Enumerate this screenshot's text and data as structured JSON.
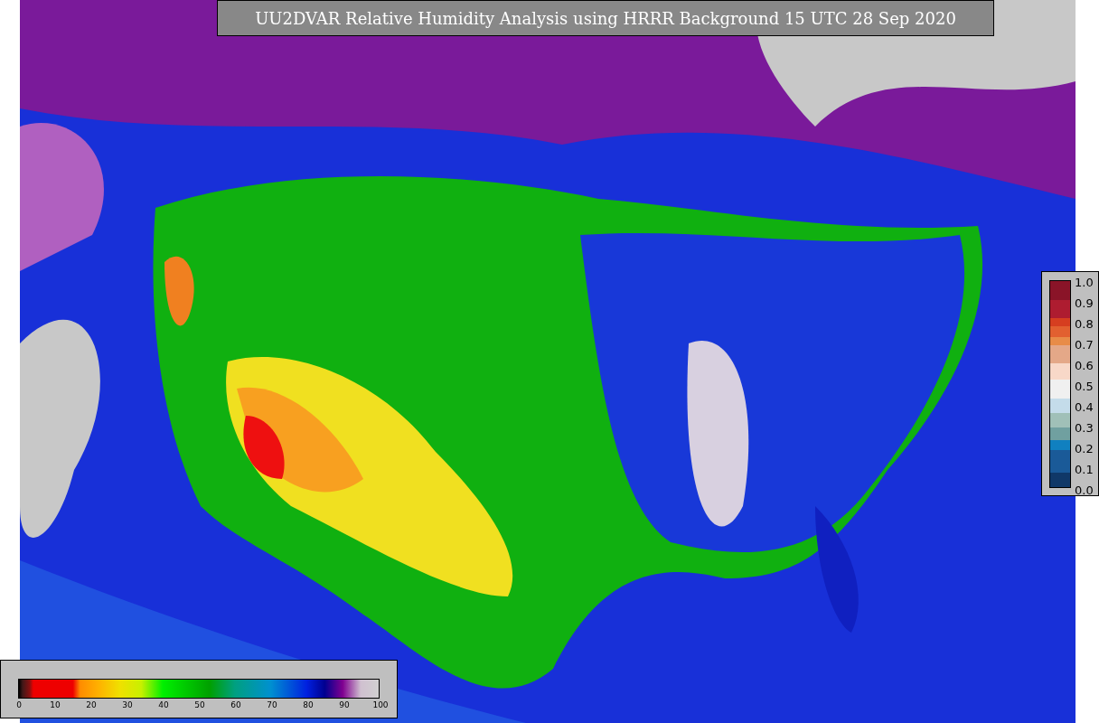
{
  "title": "UU2DVAR Relative Humidity Analysis using HRRR Background 15 UTC 28 Sep 2020",
  "humidity_scale": {
    "ticks": [
      "0",
      "10",
      "20",
      "30",
      "40",
      "50",
      "60",
      "70",
      "80",
      "90",
      "100"
    ]
  },
  "side_scale": {
    "ticks": [
      "1.0",
      "0.9",
      "0.8",
      "0.7",
      "0.6",
      "0.5",
      "0.4",
      "0.3",
      "0.2",
      "0.1",
      "0.0"
    ]
  }
}
